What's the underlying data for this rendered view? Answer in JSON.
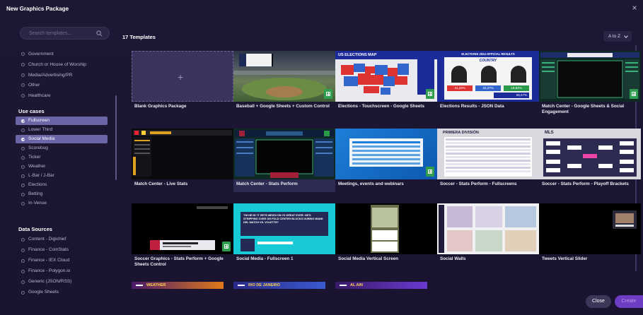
{
  "window": {
    "title": "New Graphics Package",
    "close_icon": "×"
  },
  "search": {
    "placeholder": "Search templates..."
  },
  "categories": [
    "Government",
    "Church or House of Worship",
    "Media/Advertising/PR",
    "Other",
    "Healthcare"
  ],
  "use_cases": {
    "title": "Use cases",
    "items": [
      {
        "label": "Fullscreen",
        "checked": true
      },
      {
        "label": "Lower Third",
        "checked": false
      },
      {
        "label": "Social Media",
        "checked": true
      },
      {
        "label": "Scorebug",
        "checked": false
      },
      {
        "label": "Ticker",
        "checked": false
      },
      {
        "label": "Weather",
        "checked": false
      },
      {
        "label": "L-Bar / J-Bar",
        "checked": false
      },
      {
        "label": "Elections",
        "checked": false
      },
      {
        "label": "Betting",
        "checked": false
      },
      {
        "label": "In-Venue",
        "checked": false
      }
    ]
  },
  "data_sources": {
    "title": "Data Sources",
    "items": [
      "Content - Digichief",
      "Finance - CoinStats",
      "Finance - IEX Cloud",
      "Finance - Polygon.io",
      "Generic (JSON/RSS)",
      "Google Sheets"
    ]
  },
  "main": {
    "count_label": "17 Templates",
    "sort_label": "A to Z"
  },
  "templates": [
    {
      "label": "Blank Graphics Package"
    },
    {
      "label": "Baseball + Google Sheets + Custom Control"
    },
    {
      "label": "Elections - Touchscreen - Google Sheets"
    },
    {
      "label": "Elections Results - JSON Data"
    },
    {
      "label": "Match Center - Google Sheets & Social Engagement"
    },
    {
      "label": "Match Center - Live Stats"
    },
    {
      "label": "Match Center - Stats Perform"
    },
    {
      "label": "Meetings, events and webinars"
    },
    {
      "label": "Soccer - Stats Perform - Fullscreens"
    },
    {
      "label": "Soccer - Stats Perform - Playoff Brackets"
    },
    {
      "label": "Soccer Graphics - Stats Perform + Google Sheets Control"
    },
    {
      "label": "Social Media - Fullscreen 1"
    },
    {
      "label": "Social Media Vertical Screen"
    },
    {
      "label": "Social Walls"
    },
    {
      "label": "Tweets Vertical Slider"
    }
  ],
  "thumb_text": {
    "elections_map": "US ELECTIONS MAP",
    "elections_results": "ELECTIONS 2024 OFFICIAL RESULTS",
    "elections_country": "COUNTRY",
    "pct_1": "41,22%",
    "pct_2": "32,27%",
    "pct_3": "19,84%",
    "pct_4": "59,47%",
    "primera": "PRIMERA DIVISIÓN",
    "mls": "MLS",
    "social_quote": "'I'M HE IN' IT GETS MESSI ON I'S GREAT EVER: HE'S STRIPPING OVER ON FOLD CENTER BLOCKS DURING MIAMI DEL MATCH VS. VOLETTE!'"
  },
  "next_row": [
    "WEATHER",
    "RIO DE JANEIRO",
    "AL AIN"
  ],
  "footer": {
    "close_label": "Close",
    "create_label": "Create"
  },
  "colors": {
    "accent": "#6a66a8",
    "create": "#6d3ec4",
    "sheets_green": "#2f9e4f",
    "background": "#1b1530"
  }
}
